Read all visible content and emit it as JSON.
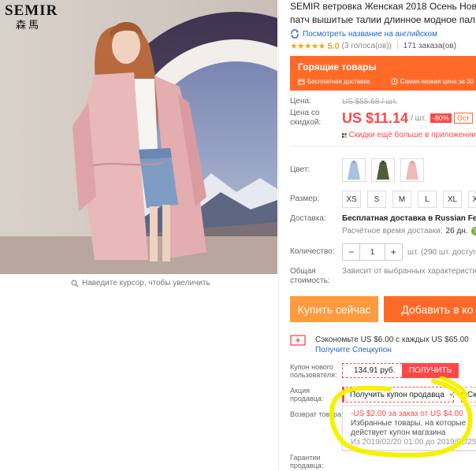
{
  "brand": {
    "name_en": "SEMIR",
    "name_cn": "森馬"
  },
  "gallery": {
    "zoom_hint": "Наведите курсор, чтобы увеличить"
  },
  "product": {
    "title_line1": "SEMIR ветровка Женская 2018 Осень Новы",
    "title_line2": "патч вышитые талии длинное модное пал",
    "translate_link": "Посмотреть название на английском",
    "rating_stars": "★★★★★",
    "rating_value": "5.0",
    "rating_count": "(3 голоса(ов))",
    "orders": "171 заказа(ов)"
  },
  "hot_deals": {
    "title": "Горящие товары",
    "free_shipping": "Бесплатная доставка",
    "lowest_price": "Самая низкая цена за 30"
  },
  "price": {
    "label": "Цена:",
    "old_value": "US $55.68 / шт.",
    "discount_label": "Цена со скидкой:",
    "new_value": "US $11.14",
    "per_unit": "/ шт.",
    "discount_badge": "-80%",
    "extra_badge": "Ост",
    "app_discount": "Скидки ещё больше в приложении"
  },
  "color": {
    "label": "Цвет:",
    "options": [
      "light-blue",
      "olive-green",
      "pink"
    ]
  },
  "size": {
    "label": "Размер:",
    "options": [
      "XS",
      "S",
      "M",
      "L",
      "XL",
      "XX"
    ]
  },
  "shipping": {
    "label": "Доставка:",
    "value": "Бесплатная доставка в Russian Fede",
    "estimate_label": "Расчётное время доставки:",
    "estimate_value": "26 дн."
  },
  "quantity": {
    "label": "Количество:",
    "minus": "−",
    "value": "1",
    "plus": "+",
    "stock": "шт. (290 шт. доступно)"
  },
  "total": {
    "label": "Общая стоимость:",
    "value": "Зависит от выбранных характеристик"
  },
  "actions": {
    "buy_now": "Купить сейчас",
    "add_to_cart": "Добавить в ко"
  },
  "savings": {
    "text": "Сэкономьте US $6.00 с каждых US $65.00",
    "link": "Получите Спецкупон"
  },
  "new_user_coupon": {
    "label": "Купон нового пользователя:",
    "price": "134,91 руб.",
    "button": "ПОЛУЧИТЬ"
  },
  "seller_promo": {
    "label": "Акция продавца:",
    "dropdown": "Получить купон продавца",
    "dropdown2": "Ск"
  },
  "coupon_popup": {
    "line1": "-US $2.00 за заказ от US $4.00",
    "line2": "Избранные товары, на которые действует купон магазина",
    "line3": "Из 2019/02/20 01:00 до 2019/02/25 23"
  },
  "returns": {
    "label": "Возврат товара"
  },
  "guarantees": {
    "label": "Гарантии продавца:"
  },
  "colors": {
    "accent": "#ff4747",
    "orange": "#ff6a28",
    "buy": "#ff9a3e",
    "link": "#1e66c8",
    "highlight": "#f5f100"
  }
}
